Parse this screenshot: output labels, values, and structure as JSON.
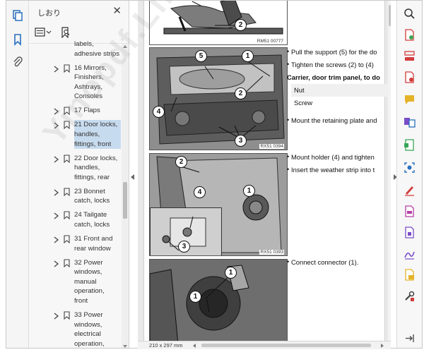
{
  "panel": {
    "title": "しおり",
    "close": "✕",
    "bookmarks": [
      {
        "text": "labels, adhesive strips",
        "lines": [
          "labels,",
          "adhesive strips"
        ],
        "selected": false
      },
      {
        "text": "16 Mirrors, Finishers, Ashtrays, Consoles",
        "lines": [
          "16 Mirrors,",
          "Finishers,",
          "Ashtrays,",
          "Consoles"
        ],
        "selected": false
      },
      {
        "text": "17 Flaps",
        "lines": [
          "17 Flaps"
        ],
        "selected": false
      },
      {
        "text": "21 Door locks, handles, fittings, front",
        "lines": [
          "21 Door locks,",
          "handles,",
          "fittings, front"
        ],
        "selected": true
      },
      {
        "text": "22 Door locks, handles, fittings, rear",
        "lines": [
          "22 Door locks,",
          "handles,",
          "fittings, rear"
        ],
        "selected": false
      },
      {
        "text": "23 Bonnet catch, locks",
        "lines": [
          "23 Bonnet",
          "catch, locks"
        ],
        "selected": false
      },
      {
        "text": "24 Tailgate catch, locks",
        "lines": [
          "24 Tailgate",
          "catch, locks"
        ],
        "selected": false
      },
      {
        "text": "31 Front and rear window",
        "lines": [
          "31 Front and",
          "rear window"
        ],
        "selected": false
      },
      {
        "text": "32 Power windows, manual operation, front",
        "lines": [
          "32 Power",
          "windows,",
          "manual",
          "operation,",
          "front"
        ],
        "selected": false
      },
      {
        "text": "33 Power windows, electrical operation, front",
        "lines": [
          "33 Power",
          "windows,",
          "electrical",
          "operation,",
          "front"
        ],
        "selected": false
      }
    ]
  },
  "doc": {
    "figures": [
      {
        "code": "RM51 00777",
        "callouts": [
          "2"
        ]
      },
      {
        "code": "RX51 0394",
        "callouts": [
          "5",
          "1",
          "2",
          "4",
          "3"
        ]
      },
      {
        "code": "RX51 0393",
        "callouts": [
          "2",
          "1",
          "4",
          "3"
        ]
      },
      {
        "code": "",
        "callouts": [
          "1",
          "1"
        ]
      }
    ],
    "text": {
      "pull_support": "Pull the support (5) for the do",
      "tighten": "Tighten the screws (2) to (4)",
      "carrier_heading": "Carrier, door trim panel, to do",
      "nut": "Nut",
      "screw": "Screw",
      "mount_plate": "Mount the retaining plate and",
      "mount_holder": "Mount holder (4) and tighten",
      "insert_weather": "Insert the weather strip into t",
      "connect": "Connect connector (1)."
    },
    "bullet": "•",
    "page_size": "210 x 297 mm"
  },
  "watermark": "Yinopdf.Link",
  "icons": {
    "rail": [
      "pages-icon",
      "bookmark-icon",
      "attachment-icon"
    ],
    "tools": [
      "zoom-search-icon",
      "create-pdf-icon",
      "organize-pages-icon",
      "export-pdf-icon",
      "comment-icon",
      "combine-files-icon",
      "compress-pdf-icon",
      "scan-ocr-icon",
      "fill-sign-icon",
      "edit-pdf-icon",
      "protect-pdf-icon",
      "request-signature-icon",
      "send-for-review-icon",
      "more-tools-icon",
      "expand-panel-icon"
    ]
  },
  "colors": {
    "selection": "#c7dbef",
    "accent_blue": "#2a6fbf",
    "tool_green": "#3aa657",
    "tool_red": "#d23c3c",
    "tool_purple": "#7a4cc7",
    "tool_yellow": "#e5b32a"
  }
}
